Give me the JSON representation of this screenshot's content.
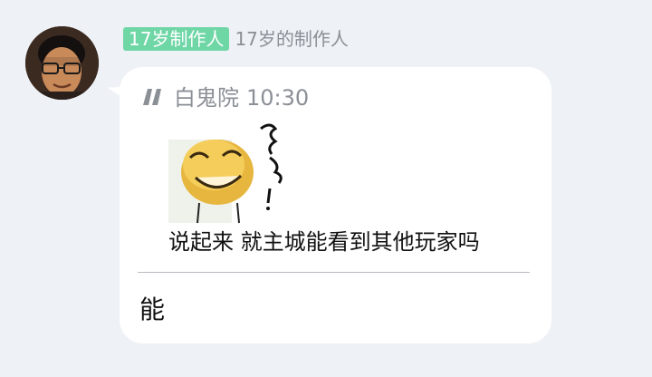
{
  "sender": {
    "avatar_icon": "user-avatar-photo",
    "title_badge": "17岁制作人",
    "badge_color": "#6fd6a6",
    "nickname": "17岁的制作人"
  },
  "message": {
    "quote": {
      "quote_icon": "quote-mark-icon",
      "author": "白鬼院",
      "time": "10:30",
      "sticker_icon": "smiley-face-sticker",
      "text": "说起来 就主城能看到其他玩家吗"
    },
    "reply": "能"
  }
}
